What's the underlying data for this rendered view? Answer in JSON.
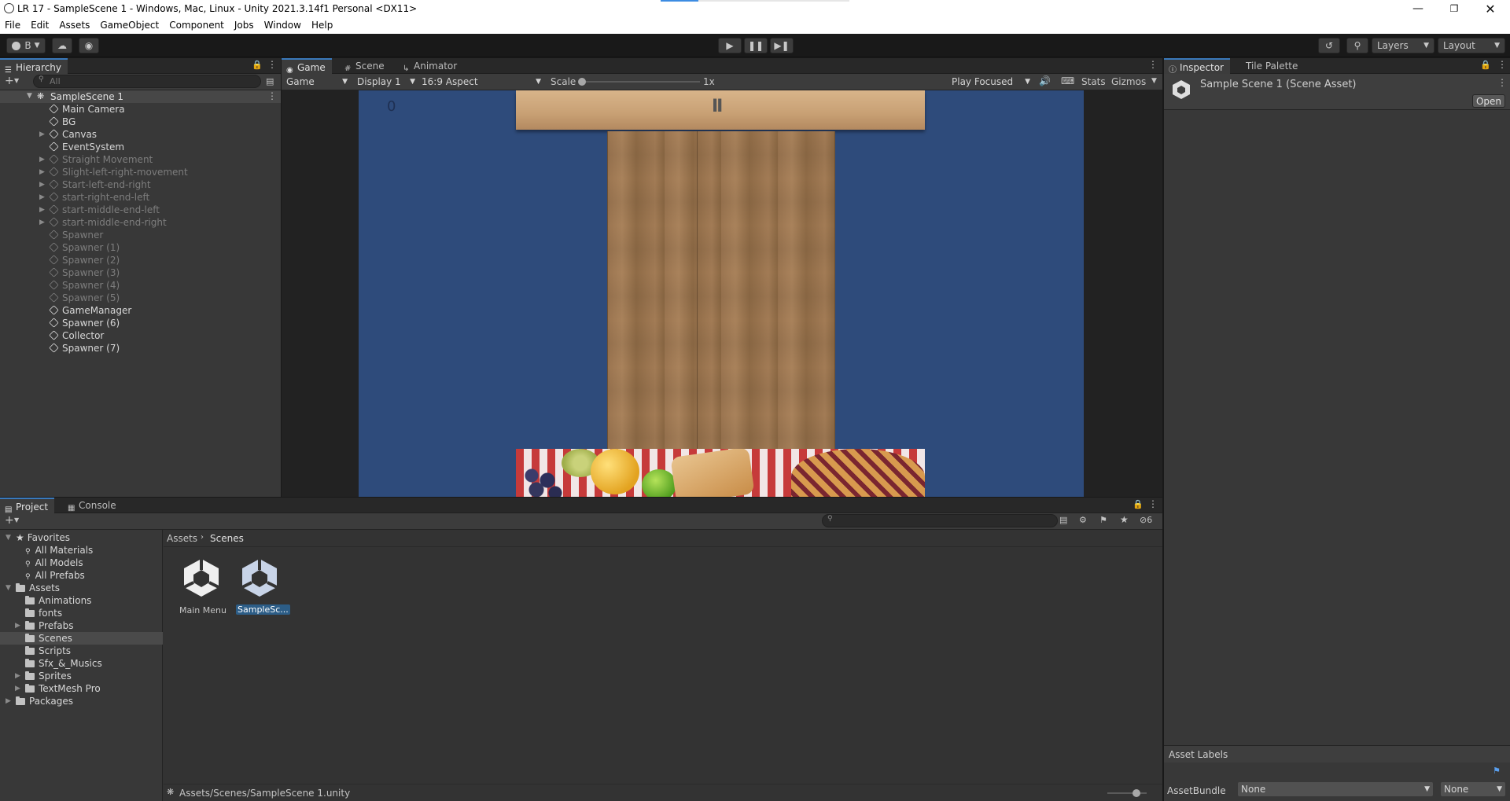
{
  "window": {
    "title": "LR 17 - SampleScene 1 - Windows, Mac, Linux - Unity 2021.3.14f1 Personal <DX11>"
  },
  "menu": [
    "File",
    "Edit",
    "Assets",
    "GameObject",
    "Component",
    "Jobs",
    "Window",
    "Help"
  ],
  "toolbar": {
    "account": "B",
    "layers": "Layers",
    "layout": "Layout"
  },
  "hierarchy": {
    "tab": "Hierarchy",
    "search_placeholder": "All",
    "scene": "SampleScene 1",
    "items": [
      {
        "label": "Main Camera",
        "active": true,
        "expandable": false
      },
      {
        "label": "BG",
        "active": true,
        "expandable": false
      },
      {
        "label": "Canvas",
        "active": true,
        "expandable": true
      },
      {
        "label": "EventSystem",
        "active": true,
        "expandable": false
      },
      {
        "label": "Straight Movement",
        "active": false,
        "expandable": true
      },
      {
        "label": "Slight-left-right-movement",
        "active": false,
        "expandable": true
      },
      {
        "label": "Start-left-end-right",
        "active": false,
        "expandable": true
      },
      {
        "label": "start-right-end-left",
        "active": false,
        "expandable": true
      },
      {
        "label": "start-middle-end-left",
        "active": false,
        "expandable": true
      },
      {
        "label": "start-middle-end-right",
        "active": false,
        "expandable": true
      },
      {
        "label": "Spawner",
        "active": false,
        "expandable": false
      },
      {
        "label": "Spawner (1)",
        "active": false,
        "expandable": false
      },
      {
        "label": "Spawner (2)",
        "active": false,
        "expandable": false
      },
      {
        "label": "Spawner (3)",
        "active": false,
        "expandable": false
      },
      {
        "label": "Spawner (4)",
        "active": false,
        "expandable": false
      },
      {
        "label": "Spawner (5)",
        "active": false,
        "expandable": false
      },
      {
        "label": "GameManager",
        "active": true,
        "expandable": false
      },
      {
        "label": "Spawner (6)",
        "active": true,
        "expandable": false
      },
      {
        "label": "Collector",
        "active": true,
        "expandable": false
      },
      {
        "label": "Spawner (7)",
        "active": true,
        "expandable": false
      }
    ]
  },
  "game": {
    "tabs": [
      "Game",
      "Scene",
      "Animator"
    ],
    "view_select": "Game",
    "display": "Display 1",
    "aspect": "16:9 Aspect",
    "scale_label": "Scale",
    "scale_value": "1x",
    "play_mode": "Play Focused",
    "stats": "Stats",
    "gizmos": "Gizmos",
    "score": "0",
    "pause_glyph": "II",
    "colors": {
      "background": "#2e4b7b",
      "wood": "#a07a52",
      "cloth": "#c63a3a"
    }
  },
  "inspector": {
    "tabs": [
      "Inspector",
      "Tile Palette"
    ],
    "title": "Sample Scene 1 (Scene Asset)",
    "open": "Open",
    "asset_labels": "Asset Labels",
    "assetbundle_label": "AssetBundle",
    "assetbundle_value": "None",
    "variant_value": "None"
  },
  "project": {
    "tabs": [
      "Project",
      "Console"
    ],
    "hidden_count": "6",
    "favorites_label": "Favorites",
    "favorites": [
      "All Materials",
      "All Models",
      "All Prefabs"
    ],
    "assets_label": "Assets",
    "folders": [
      {
        "label": "Animations",
        "expandable": false
      },
      {
        "label": "fonts",
        "expandable": false
      },
      {
        "label": "Prefabs",
        "expandable": true
      },
      {
        "label": "Scenes",
        "expandable": false
      },
      {
        "label": "Scripts",
        "expandable": false
      },
      {
        "label": "Sfx_&_Musics",
        "expandable": false
      },
      {
        "label": "Sprites",
        "expandable": true
      },
      {
        "label": "TextMesh Pro",
        "expandable": true
      }
    ],
    "packages_label": "Packages",
    "breadcrumb": [
      "Assets",
      "Scenes"
    ],
    "files": [
      "Main Menu",
      "SampleSc..."
    ],
    "status_path": "Assets/Scenes/SampleScene 1.unity"
  }
}
